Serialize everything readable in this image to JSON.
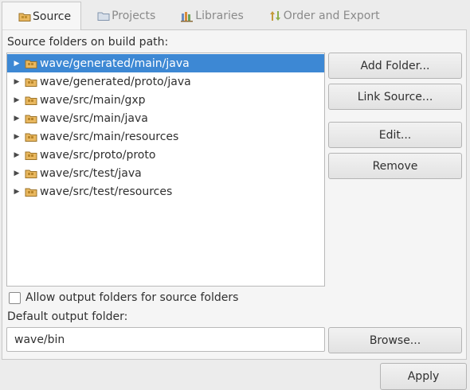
{
  "tabs": [
    {
      "label": "Source",
      "icon": "source-folder-icon",
      "active": true
    },
    {
      "label": "Projects",
      "icon": "projects-folder-icon",
      "active": false
    },
    {
      "label": "Libraries",
      "icon": "libraries-icon",
      "active": false
    },
    {
      "label": "Order and Export",
      "icon": "order-export-icon",
      "active": false
    }
  ],
  "source": {
    "heading": "Source folders on build path:",
    "folders": [
      "wave/generated/main/java",
      "wave/generated/proto/java",
      "wave/src/main/gxp",
      "wave/src/main/java",
      "wave/src/main/resources",
      "wave/src/proto/proto",
      "wave/src/test/java",
      "wave/src/test/resources"
    ],
    "selected_index": 0
  },
  "buttons": {
    "add_folder": "Add Folder...",
    "link_source": "Link Source...",
    "edit": "Edit...",
    "remove": "Remove",
    "browse": "Browse...",
    "apply": "Apply"
  },
  "allow_output": {
    "label": "Allow output folders for source folders",
    "checked": false
  },
  "output": {
    "label": "Default output folder:",
    "value": "wave/bin"
  },
  "colors": {
    "selection": "#3d88d4",
    "panel": "#f5f5f5",
    "window": "#ececec"
  }
}
